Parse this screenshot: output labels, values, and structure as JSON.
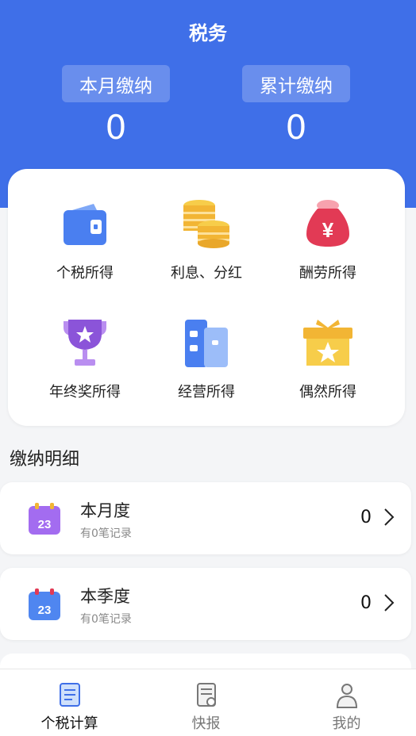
{
  "header": {
    "title": "税务",
    "monthly_label": "本月缴纳",
    "monthly_value": "0",
    "total_label": "累计缴纳",
    "total_value": "0"
  },
  "categories": [
    {
      "label": "个税所得",
      "icon": "wallet-icon"
    },
    {
      "label": "利息、分红",
      "icon": "coins-icon"
    },
    {
      "label": "酬劳所得",
      "icon": "money-bag-icon"
    },
    {
      "label": "年终奖所得",
      "icon": "trophy-icon"
    },
    {
      "label": "经营所得",
      "icon": "building-icon"
    },
    {
      "label": "偶然所得",
      "icon": "gift-box-icon"
    }
  ],
  "details": {
    "section_title": "缴纳明细",
    "rows": [
      {
        "title": "本月度",
        "subtitle": "有0笔记录",
        "value": "0",
        "icon": "calendar-icon",
        "color": "#a36cf0"
      },
      {
        "title": "本季度",
        "subtitle": "有0笔记录",
        "value": "0",
        "icon": "calendar-icon",
        "color": "#4f86f0"
      }
    ]
  },
  "tabbar": {
    "tabs": [
      {
        "label": "个税计算",
        "icon": "calculator-doc-icon",
        "active": true
      },
      {
        "label": "快报",
        "icon": "report-icon",
        "active": false
      },
      {
        "label": "我的",
        "icon": "person-icon",
        "active": false
      }
    ]
  },
  "colors": {
    "primary": "#3f6fe8",
    "text": "#222222",
    "muted": "#8a8a8a"
  }
}
